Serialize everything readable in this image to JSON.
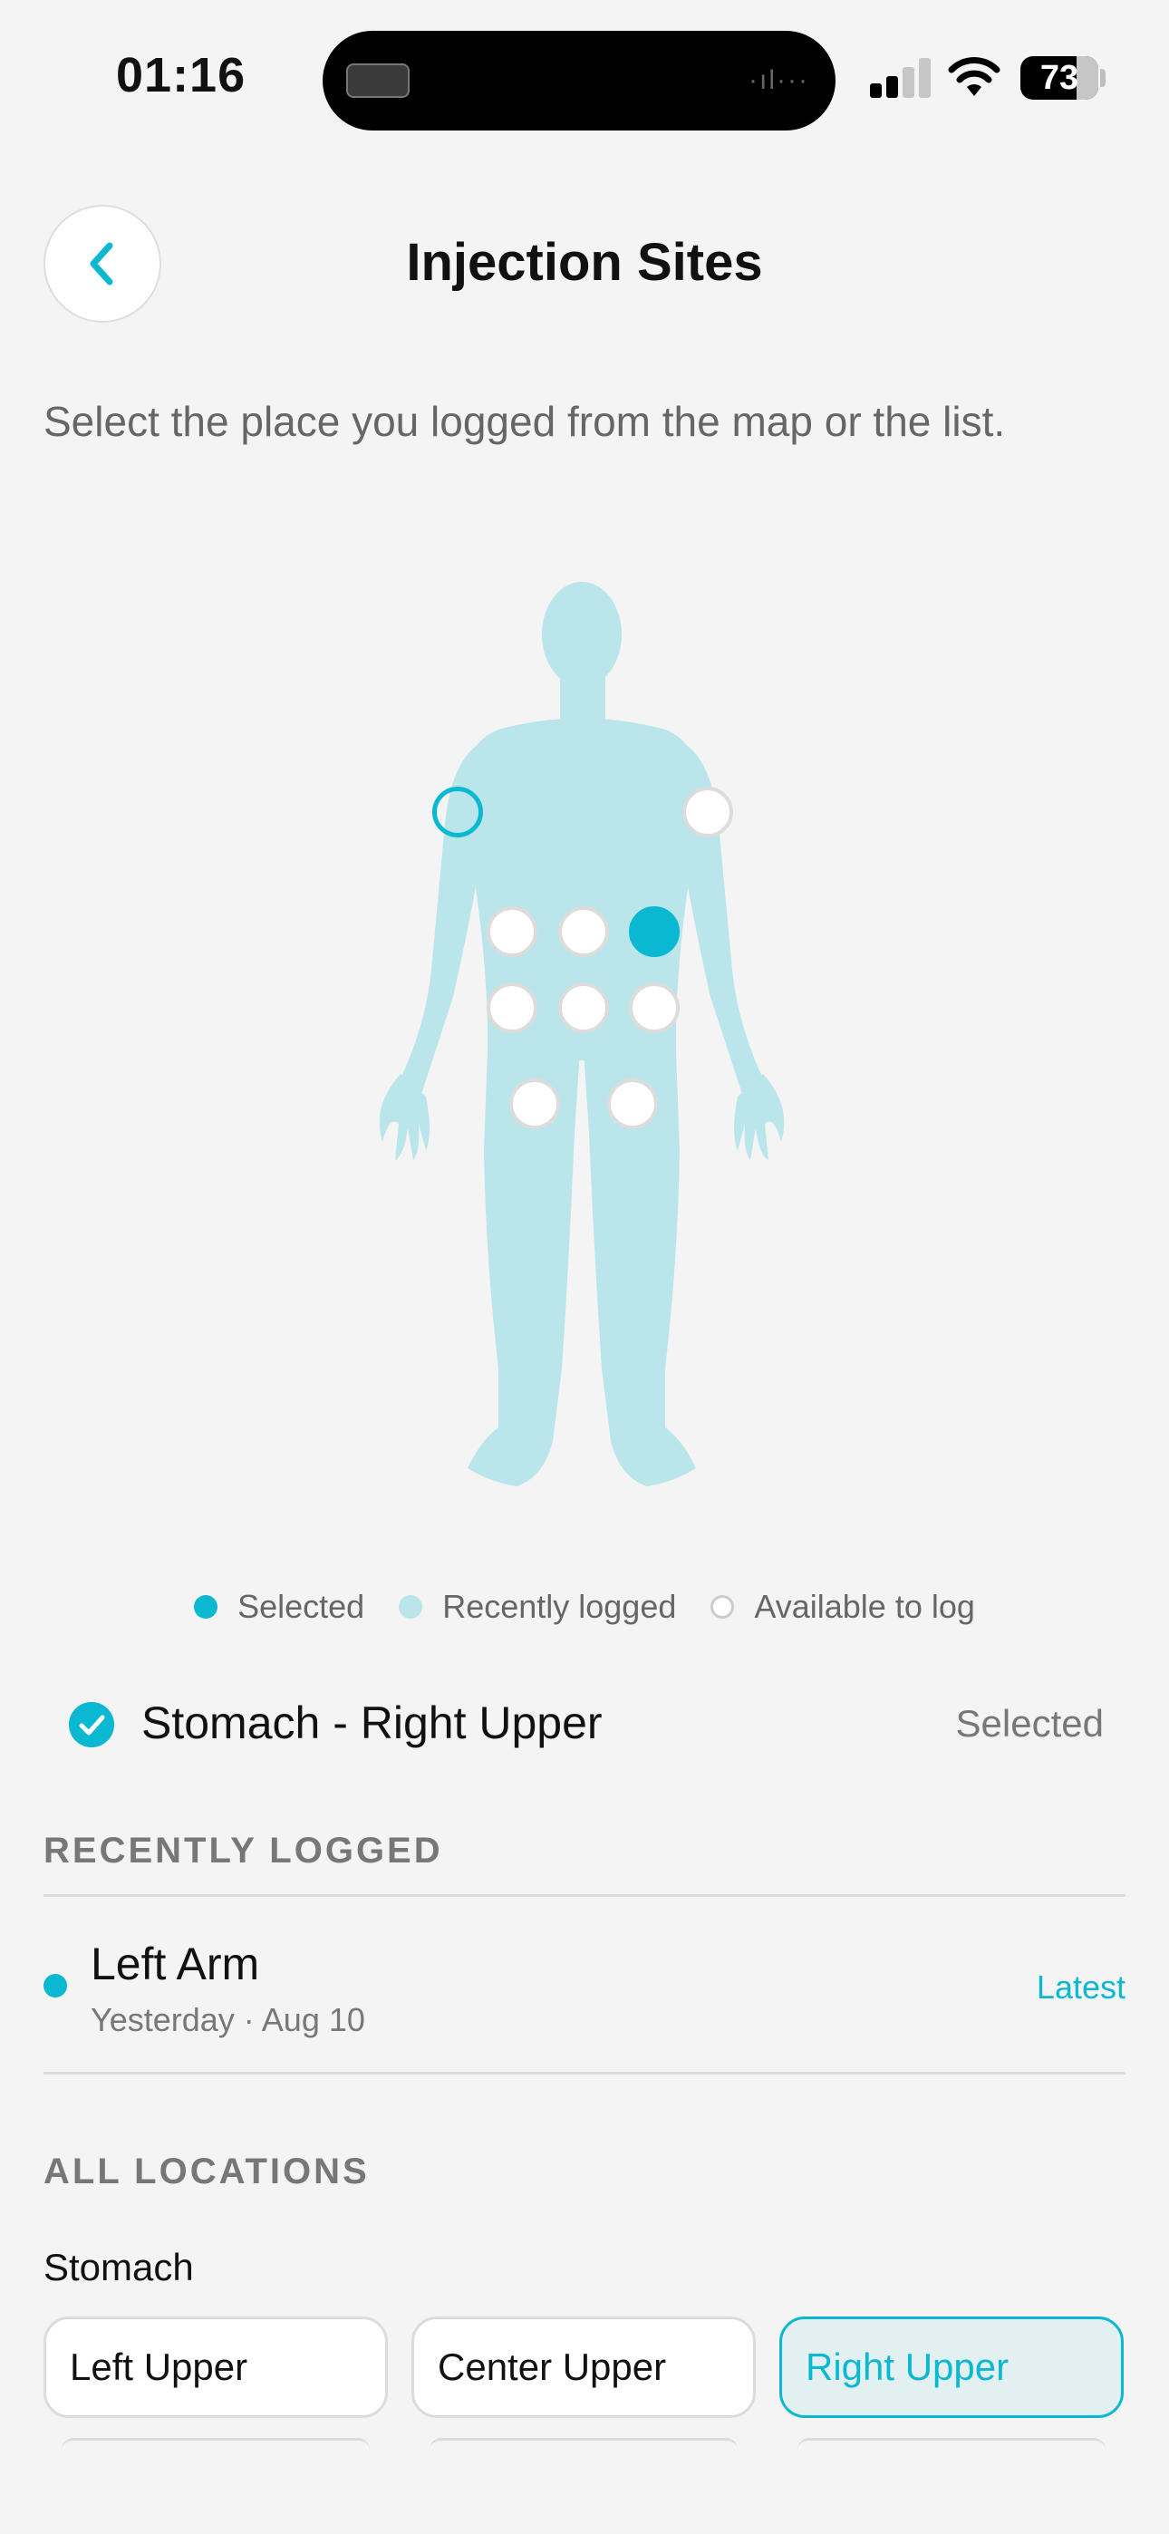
{
  "status_bar": {
    "time": "01:16",
    "battery": "73"
  },
  "header": {
    "title": "Injection Sites"
  },
  "subtitle": "Select the place you logged from the map or the list.",
  "colors": {
    "accent": "#0bb8d2",
    "body": "#b9e5eb",
    "background": "#f4f4f4"
  },
  "legend": {
    "selected": "Selected",
    "recently_logged": "Recently logged",
    "available": "Available to log"
  },
  "selection": {
    "label": "Stomach - Right Upper",
    "status": "Selected"
  },
  "recently_logged": {
    "heading": "RECENTLY LOGGED",
    "items": [
      {
        "name": "Left Arm",
        "date": "Yesterday · Aug 10",
        "tag": "Latest"
      }
    ]
  },
  "all_locations": {
    "heading": "ALL LOCATIONS",
    "groups": [
      {
        "name": "Stomach",
        "options": [
          "Left Upper",
          "Center Upper",
          "Right Upper"
        ],
        "selected": "Right Upper"
      }
    ]
  },
  "icons": {
    "back": "chevron-left-icon",
    "check": "check-circle-icon",
    "signal": "cellular-signal-icon",
    "wifi": "wifi-icon",
    "battery": "battery-icon"
  }
}
